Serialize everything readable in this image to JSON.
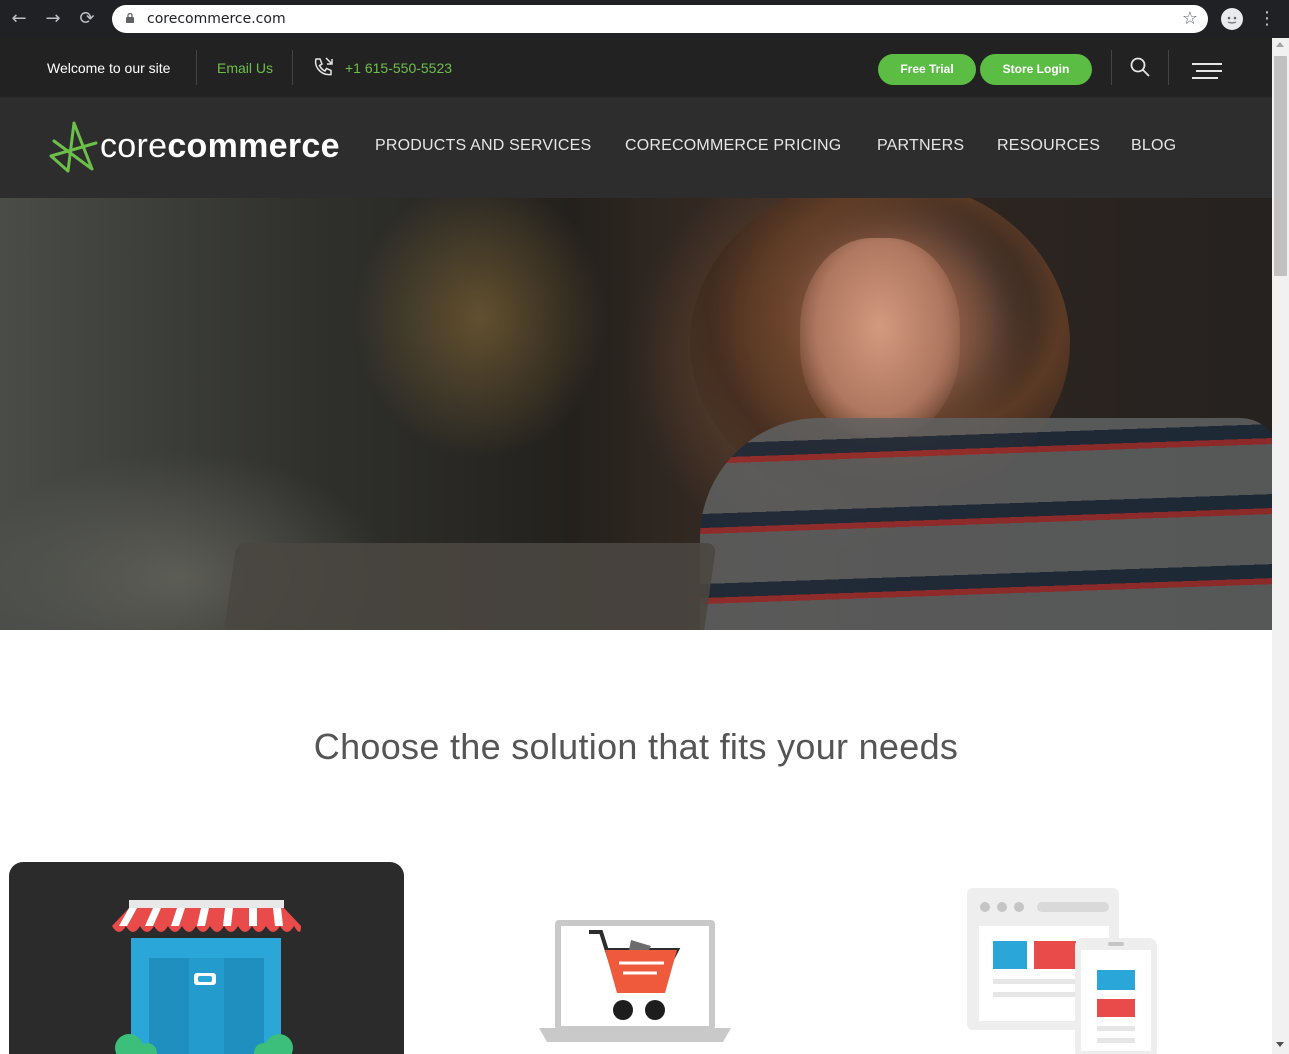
{
  "browser": {
    "url": "corecommerce.com",
    "icons": {
      "back": "arrow-left-icon",
      "forward": "arrow-right-icon",
      "reload": "reload-icon",
      "lock": "lock-icon",
      "bookmark": "star-icon",
      "profile": "profile-icon",
      "menu": "more-vert-icon"
    }
  },
  "topbar": {
    "welcome": "Welcome to our site",
    "email": "Email Us",
    "phone": "+1 615-550-5523",
    "free_trial": "Free Trial",
    "store_login": "Store Login",
    "accent_color": "#6cc04a"
  },
  "brand": {
    "name_light": "core",
    "name_bold": "commerce"
  },
  "nav": {
    "items": [
      "PRODUCTS AND SERVICES",
      "CORECOMMERCE PRICING",
      "PARTNERS",
      "RESOURCES",
      "BLOG"
    ]
  },
  "solutions": {
    "heading": "Choose the solution that fits your needs",
    "cards": [
      "storefront-illustration",
      "shopping-cart-laptop-illustration",
      "multi-device-illustration"
    ]
  }
}
